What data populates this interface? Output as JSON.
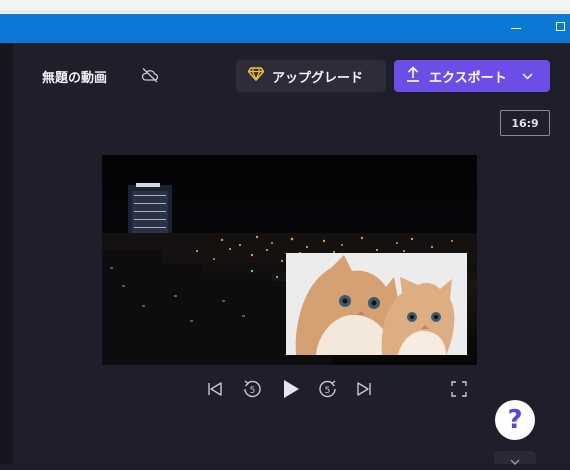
{
  "window": {
    "minimize_icon": "minimize-icon",
    "maximize_icon": "maximize-icon"
  },
  "header": {
    "project_title": "無題の動画",
    "cloud_status_icon": "cloud-off-icon",
    "upgrade": {
      "label": "アップグレード",
      "icon": "diamond-icon"
    },
    "export": {
      "label": "エクスポート",
      "icon": "upload-icon",
      "dropdown_icon": "chevron-down-icon"
    }
  },
  "canvas": {
    "aspect_ratio": "16:9",
    "background_clip": "night-city-skyline",
    "overlay_clip": "kittens-image"
  },
  "playback": {
    "controls": [
      {
        "name": "skip-to-start-button",
        "icon": "skip-back-icon"
      },
      {
        "name": "rewind-5-button",
        "icon": "rewind-5-icon",
        "label": "5"
      },
      {
        "name": "play-button",
        "icon": "play-icon"
      },
      {
        "name": "forward-5-button",
        "icon": "forward-5-icon",
        "label": "5"
      },
      {
        "name": "skip-to-end-button",
        "icon": "skip-forward-icon"
      },
      {
        "name": "fullscreen-button",
        "icon": "fullscreen-icon"
      }
    ]
  },
  "help": {
    "label": "?"
  },
  "colors": {
    "titlebar": "#0b78d6",
    "panel": "#1f1f2b",
    "accent": "#6c4ee6",
    "upgrade_diamond": "#f5c02a"
  }
}
